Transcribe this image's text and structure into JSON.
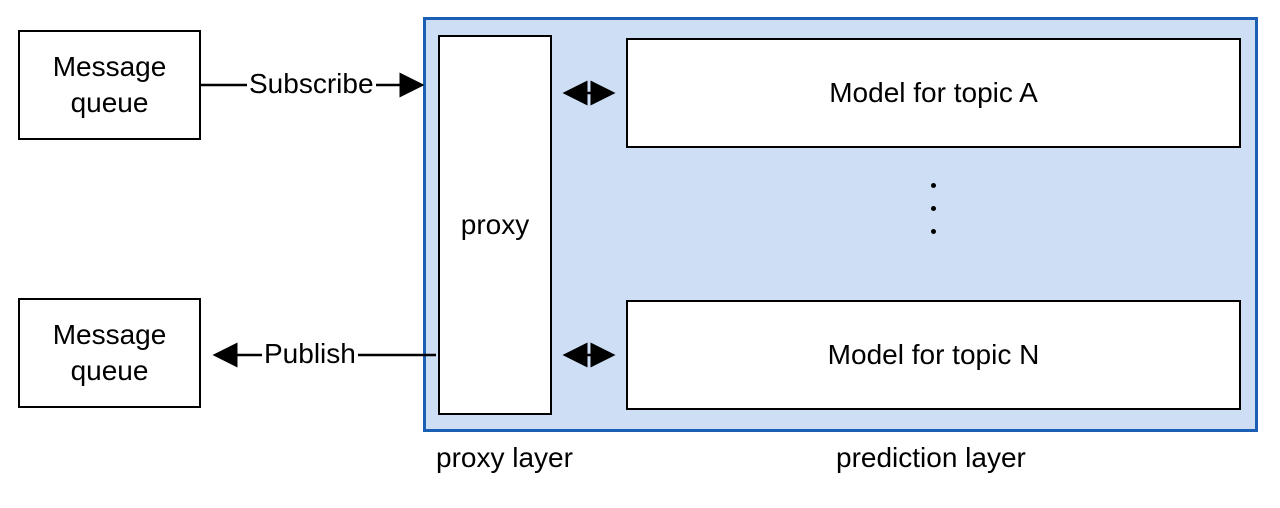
{
  "chart_data": {
    "type": "diagram",
    "title": "",
    "nodes": [
      {
        "id": "mq1",
        "label": "Message\nqueue"
      },
      {
        "id": "mq2",
        "label": "Message\nqueue"
      },
      {
        "id": "proxy",
        "label": "proxy"
      },
      {
        "id": "modelA",
        "label": "Model for topic A"
      },
      {
        "id": "modelN",
        "label": "Model for topic N"
      }
    ],
    "edges": [
      {
        "from": "mq1",
        "to": "proxy",
        "label": "Subscribe",
        "direction": "forward"
      },
      {
        "from": "proxy",
        "to": "mq2",
        "label": "Publish",
        "direction": "forward"
      },
      {
        "from": "proxy",
        "to": "modelA",
        "label": "",
        "direction": "both"
      },
      {
        "from": "proxy",
        "to": "modelN",
        "label": "",
        "direction": "both"
      }
    ],
    "groups": [
      {
        "label": "proxy layer",
        "members": [
          "proxy"
        ]
      },
      {
        "label": "prediction layer",
        "members": [
          "modelA",
          "modelN"
        ]
      }
    ]
  },
  "boxes": {
    "mq1": "Message\nqueue",
    "mq2": "Message\nqueue",
    "proxy": "proxy",
    "modelA": "Model for topic A",
    "modelN": "Model for topic N"
  },
  "edgeLabels": {
    "subscribe": "Subscribe",
    "publish": "Publish"
  },
  "groupLabels": {
    "proxy": "proxy layer",
    "prediction": "prediction layer"
  }
}
